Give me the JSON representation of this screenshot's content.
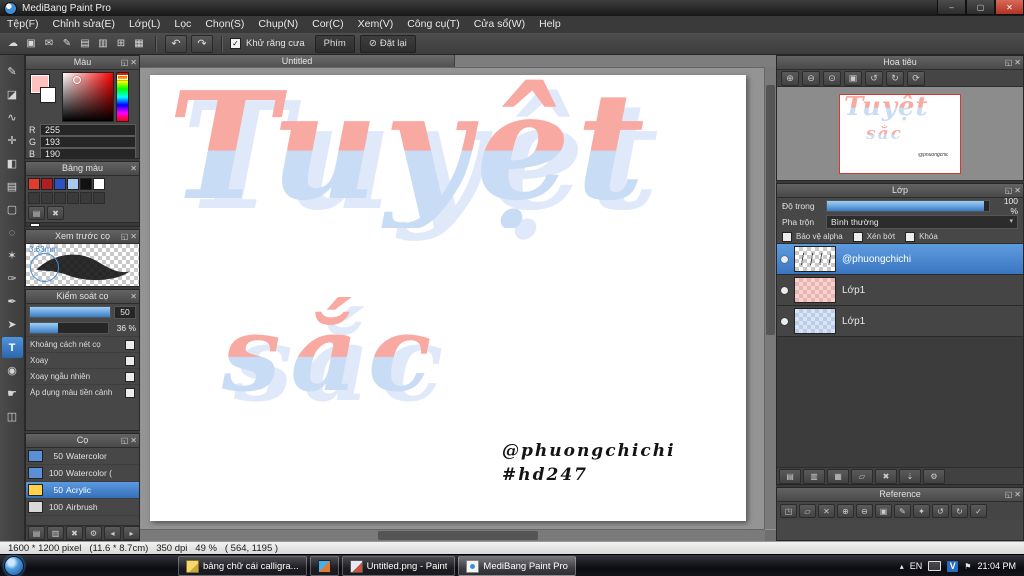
{
  "window": {
    "title": "MediBang Paint Pro",
    "controls": {
      "minimize": "–",
      "maximize": "▢",
      "close": "✕"
    }
  },
  "menubar": {
    "items": [
      "Tệp(F)",
      "Chỉnh sửa(E)",
      "Lớp(L)",
      "Lọc",
      "Chọn(S)",
      "Chụp(N)",
      "Cor(C)",
      "Xem(V)",
      "Công cụ(T)",
      "Cửa sổ(W)",
      "Help"
    ]
  },
  "toolbar": {
    "icons": [
      {
        "name": "cloud-icon",
        "glyph": "☁"
      },
      {
        "name": "save-icon",
        "glyph": "▣"
      },
      {
        "name": "comment-icon",
        "glyph": "✉"
      },
      {
        "name": "brush-edit-icon",
        "glyph": "✎"
      },
      {
        "name": "new-canvas-icon",
        "glyph": "▤"
      },
      {
        "name": "canvas-list-icon",
        "glyph": "▥"
      },
      {
        "name": "grid-icon",
        "glyph": "⊞"
      },
      {
        "name": "material-panel-icon",
        "glyph": "▦"
      }
    ],
    "undo_glyph": "↶",
    "redo_glyph": "↷",
    "antialias_check": "✓",
    "antialias_label": "Khử răng cưa",
    "keys_button": "Phím",
    "reset_glyph": "⊘",
    "reset_button": "Đặt lại"
  },
  "toolstrip": {
    "tools": [
      {
        "name": "brush-tool",
        "glyph": "✎"
      },
      {
        "name": "eraser-tool",
        "glyph": "◪"
      },
      {
        "name": "smudge-tool",
        "glyph": "∿"
      },
      {
        "name": "move-tool",
        "glyph": "✛"
      },
      {
        "name": "fill-tool",
        "glyph": "◧"
      },
      {
        "name": "gradient-tool",
        "glyph": "▤"
      },
      {
        "name": "select-tool",
        "glyph": "▢"
      },
      {
        "name": "lasso-tool",
        "glyph": "◌"
      },
      {
        "name": "magic-wand-tool",
        "glyph": "✶"
      },
      {
        "name": "select-pen-tool",
        "glyph": "✑"
      },
      {
        "name": "select-eraser-tool",
        "glyph": "✒"
      },
      {
        "name": "operation-tool",
        "glyph": "➤"
      },
      {
        "name": "text-tool",
        "glyph": "T",
        "selected": true
      },
      {
        "name": "eyedropper-tool",
        "glyph": "◉"
      },
      {
        "name": "hand-tool",
        "glyph": "☛"
      },
      {
        "name": "divide-tool",
        "glyph": "◫"
      }
    ]
  },
  "color_panel": {
    "title": "Màu",
    "r_label": "R",
    "r_value": "255",
    "g_label": "G",
    "g_value": "193",
    "b_label": "B",
    "b_value": "190",
    "foreground_hex": "#ffc1be",
    "background_hex": "#ffffff"
  },
  "palette_panel": {
    "title": "Bảng màu",
    "swatches": [
      {
        "name": "palette-swatch-red",
        "bg": "#e23b2e"
      },
      {
        "name": "palette-swatch-darkred",
        "bg": "#b01f1f"
      },
      {
        "name": "palette-swatch-blue",
        "bg": "#2f4fc4"
      },
      {
        "name": "palette-swatch-lightblue",
        "bg": "#a9c9f1"
      },
      {
        "name": "palette-swatch-black",
        "bg": "#111111"
      },
      {
        "name": "palette-swatch-white",
        "bg": "#ffffff"
      }
    ],
    "icons": [
      {
        "name": "add-swatch-icon",
        "glyph": "▤"
      },
      {
        "name": "delete-swatch-icon",
        "glyph": "✖"
      }
    ],
    "entry_label": "---"
  },
  "brush_preview_panel": {
    "title": "Xem trước cọ",
    "size_label": "3.63mm"
  },
  "brush_control_panel": {
    "title": "Kiểm soát cọ",
    "size_value": "50",
    "size_fill_css": "width:100%",
    "opacity_value": "36 %",
    "opacity_fill_css": "width:36%",
    "options": [
      "Khoảng cách nét cọ",
      "Xoay",
      "Xoay ngẫu nhiên",
      "Áp dụng màu tiền cảnh"
    ]
  },
  "brush_panel": {
    "title": "Cọ",
    "items": [
      {
        "name": "brush-watercolor-50",
        "size": "50",
        "label": "Watercolor",
        "bg": "#5b8fd6"
      },
      {
        "name": "brush-watercolor-100",
        "size": "100",
        "label": "Watercolor (",
        "bg": "#5b8fd6"
      },
      {
        "name": "brush-acrylic-50",
        "size": "50",
        "label": "Acrylic",
        "bg": "#ffd24a",
        "selected": true
      },
      {
        "name": "brush-airbrush-100",
        "size": "100",
        "label": "Airbrush",
        "bg": "#d8d8d8"
      }
    ],
    "footer_icons": [
      {
        "name": "add-brush-icon",
        "glyph": "▤"
      },
      {
        "name": "duplicate-brush-icon",
        "glyph": "▥"
      },
      {
        "name": "delete-brush-icon",
        "glyph": "✖"
      },
      {
        "name": "brush-settings-icon",
        "glyph": "⚙"
      },
      {
        "name": "brush-prev-icon",
        "glyph": "◂"
      },
      {
        "name": "brush-next-icon",
        "glyph": "▸"
      }
    ]
  },
  "canvas": {
    "tab_title": "Untitled",
    "art_line1": "Tuyệt",
    "art_line2": "sắc",
    "signature_line1": "@phuongchichi",
    "signature_line2": "#hd247",
    "art_pink_hex": "#f8a9a2",
    "art_blue_hex": "#c9dcf5"
  },
  "navigator_panel": {
    "title": "Hoa tiêu",
    "icons": [
      {
        "name": "zoom-in-icon",
        "glyph": "⊕"
      },
      {
        "name": "zoom-out-icon",
        "glyph": "⊖"
      },
      {
        "name": "zoom-fit-icon",
        "glyph": "⊙"
      },
      {
        "name": "zoom-actual-icon",
        "glyph": "▣"
      },
      {
        "name": "rotate-left-icon",
        "glyph": "↺"
      },
      {
        "name": "rotate-right-icon",
        "glyph": "↻"
      },
      {
        "name": "rotate-reset-icon",
        "glyph": "⟳"
      }
    ]
  },
  "layer_panel": {
    "title": "Lớp",
    "opacity_label": "Độ trong",
    "opacity_value": "100 %",
    "opacity_fill_css": "width:97%",
    "blend_label": "Pha trộn",
    "blend_value": "Bình thường",
    "blend_arrow": "▾",
    "alpha_lock_label": "Bảo vệ alpha",
    "clipping_label": "Xén bớt",
    "lock_label": "Khóa",
    "layers": [
      {
        "name": "layer-row-phuongchichi",
        "label": "@phuongchichi",
        "tint": "signature",
        "selected": true
      },
      {
        "name": "layer-row-lop1-a",
        "label": "Lớp1",
        "tint": "pink"
      },
      {
        "name": "layer-row-lop1-b",
        "label": "Lớp1",
        "tint": "blue"
      }
    ],
    "footer_icons": [
      {
        "name": "add-layer-icon",
        "glyph": "▤"
      },
      {
        "name": "duplicate-layer-icon",
        "glyph": "▥"
      },
      {
        "name": "layer-material-icon",
        "glyph": "▦"
      },
      {
        "name": "layer-folder-icon",
        "glyph": "▱"
      },
      {
        "name": "delete-layer-icon",
        "glyph": "✖"
      },
      {
        "name": "merge-down-icon",
        "glyph": "⇣"
      },
      {
        "name": "layer-settings-icon",
        "glyph": "⚙"
      }
    ]
  },
  "reference_panel": {
    "title": "Reference",
    "icons": [
      {
        "name": "ref-prev-icon",
        "glyph": "◳"
      },
      {
        "name": "ref-folder-icon",
        "glyph": "▱"
      },
      {
        "name": "ref-close-icon",
        "glyph": "✕"
      },
      {
        "name": "ref-zoom-in-icon",
        "glyph": "⊕"
      },
      {
        "name": "ref-zoom-out-icon",
        "glyph": "⊖"
      },
      {
        "name": "ref-actual-size-icon",
        "glyph": "▣"
      },
      {
        "name": "ref-pencil-icon",
        "glyph": "✎"
      },
      {
        "name": "ref-eyedropper-icon",
        "glyph": "✦"
      },
      {
        "name": "ref-rotate-left-icon",
        "glyph": "↺"
      },
      {
        "name": "ref-rotate-right-icon",
        "glyph": "↻"
      },
      {
        "name": "ref-check-icon",
        "glyph": "✓"
      }
    ]
  },
  "panel_icons": {
    "popout": "◱",
    "close": "✕"
  },
  "statusbar": {
    "text": "1600 * 1200 pixel   (11.6 * 8.7cm)   350 dpi   49 %   ( 564, 1195 )"
  },
  "taskbar": {
    "buttons": [
      {
        "label": "bảng chữ cái calligra..."
      },
      {
        "label": ""
      },
      {
        "label": "Untitled.png - Paint"
      },
      {
        "label": "MediBang Paint Pro",
        "active": true
      }
    ],
    "tray": {
      "chevron": "▴",
      "lang": "EN",
      "unikey": "V",
      "flag": "⚑",
      "time": "21:04 PM"
    }
  }
}
